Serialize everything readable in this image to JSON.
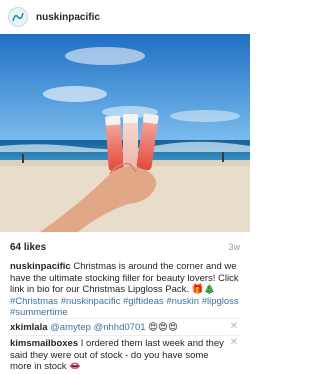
{
  "header": {
    "username": "nuskinpacific"
  },
  "post": {
    "likes": "64 likes",
    "time_ago": "3w",
    "caption": {
      "author": "nuskinpacific",
      "text": "Christmas is around the corner and we have the ultimate stocking filler for beauty lovers! Click link in bio for our Christmas Lipgloss Pack. 🎁🎄",
      "hashtags": [
        "#Christmas",
        "#nuskinpacific",
        "#giftideas",
        "#nuskin",
        "#lipgloss",
        "#summertime"
      ]
    }
  },
  "comments": [
    {
      "author": "xkimlala",
      "mentions": [
        "@amytep",
        "@nhhd0701"
      ],
      "emoji": "😍😍😍"
    },
    {
      "author": "kimsmailboxes",
      "text": "I ordered them last week and they said they were out of stock - do you have some more in stock",
      "emoji": "👄"
    }
  ],
  "icons": {
    "avatar": "nuskin-logo-icon",
    "close": "close-icon"
  },
  "colors": {
    "hashtag": "#3f729b",
    "sky": "#2f86d6",
    "sea": "#1a6fa3",
    "sand": "#e9dfcf"
  }
}
